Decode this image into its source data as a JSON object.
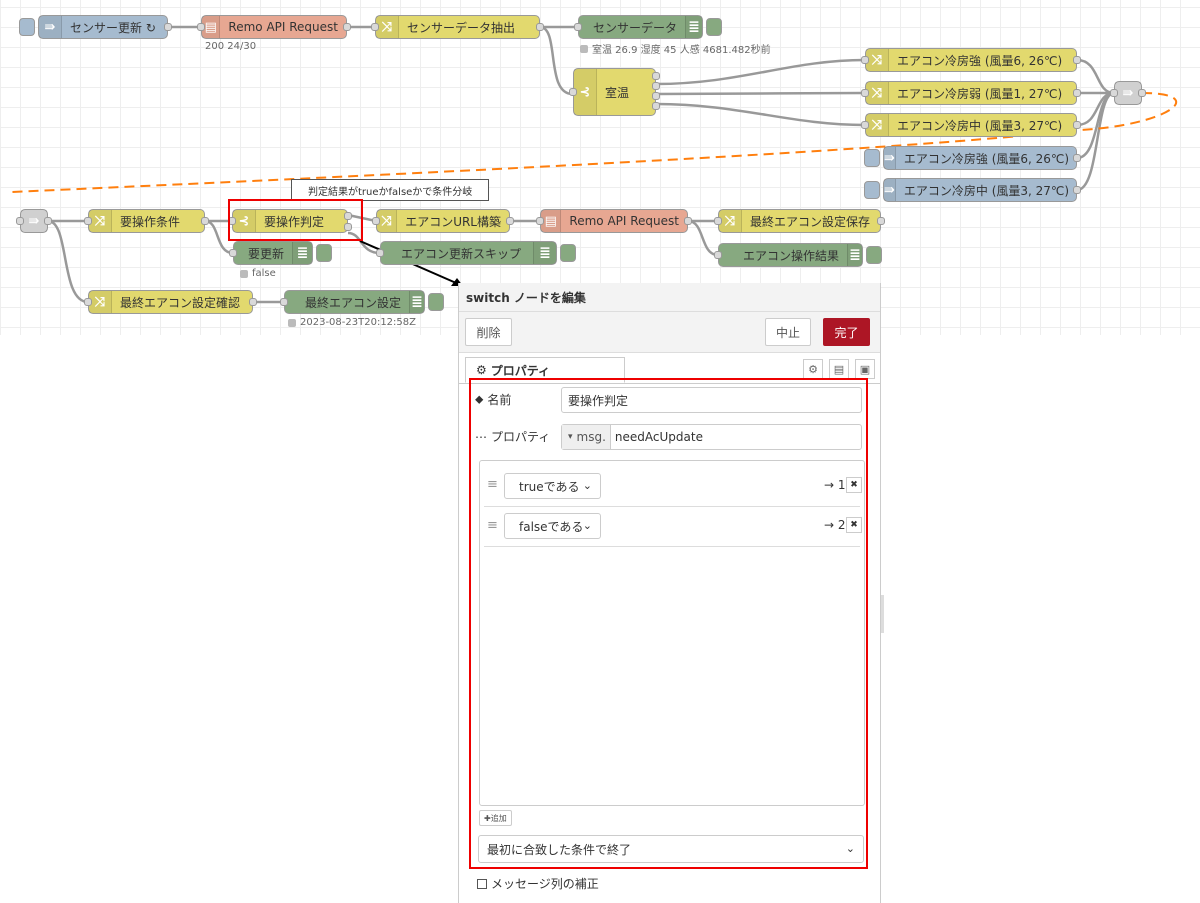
{
  "flow": {
    "nodes": {
      "sensor_update": "センサー更新 ↻",
      "remo_api_request_1": "Remo API Request",
      "remo_status_1": "200 24/30",
      "sensor_extract": "センサーデータ抽出",
      "sensor_data": "センサーデータ",
      "sensor_status": "室温 26.9 湿度 45 人感 4681.482秒前",
      "room_temp": "室温",
      "ac_strong": "エアコン冷房強 (風量6, 26℃)",
      "ac_weak": "エアコン冷房弱 (風量1, 27℃)",
      "ac_mid": "エアコン冷房中 (風量3, 27℃)",
      "inject_strong": "エアコン冷房強 (風量6, 26℃)",
      "inject_mid": "エアコン冷房中 (風量3, 27℃)",
      "need_op_condition": "要操作条件",
      "need_op_judge": "要操作判定",
      "ac_url_build": "エアコンURL構築",
      "remo_api_request_2": "Remo API Request",
      "last_ac_save": "最終エアコン設定保存",
      "need_update": "要更新",
      "need_update_status": "false",
      "ac_update_skip": "エアコン更新スキップ",
      "ac_op_result": "エアコン操作結果",
      "last_ac_confirm": "最終エアコン設定確認",
      "last_ac_setting": "最終エアコン設定",
      "last_ac_status": "2023-08-23T20:12:58Z"
    },
    "annotation": "判定結果がtrueかfalseかで条件分岐"
  },
  "editor": {
    "title": "switch ノードを編集",
    "delete_label": "削除",
    "cancel_label": "中止",
    "done_label": "完了",
    "tab_properties": "プロパティ",
    "name_label": "名前",
    "name_value": "要操作判定",
    "property_label": "プロパティ",
    "property_prefix": "msg.",
    "property_value": "needAcUpdate",
    "rules": [
      {
        "condition": "trueである",
        "output": "→ 1"
      },
      {
        "condition": "falseである",
        "output": "→ 2"
      }
    ],
    "add_label": "追加",
    "mode_value": "最初に合致した条件で終了",
    "recreate_label": "メッセージ列の補正"
  },
  "colors": {
    "change_node": "#e2d96e",
    "inject_node": "#a6bbcf",
    "http_node": "#e7a792",
    "debug_node": "#87a980",
    "highlight": "#ee0000",
    "primary_button": "#ad1625"
  }
}
